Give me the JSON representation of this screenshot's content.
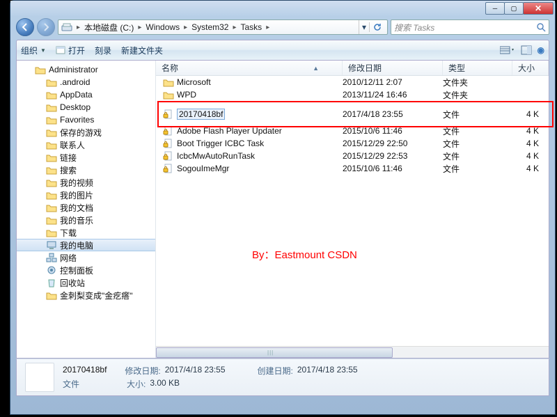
{
  "breadcrumb": {
    "items": [
      "本地磁盘 (C:)",
      "Windows",
      "System32",
      "Tasks"
    ]
  },
  "search": {
    "placeholder": "搜索 Tasks"
  },
  "toolbar": {
    "organize": "组织",
    "open": "打开",
    "burn": "刻录",
    "newfolder": "新建文件夹"
  },
  "tree": {
    "root": "Administrator",
    "items": [
      ".android",
      "AppData",
      "Desktop",
      "Favorites",
      "保存的游戏",
      "联系人",
      "链接",
      "搜索",
      "我的视频",
      "我的图片",
      "我的文档",
      "我的音乐",
      "下载",
      "我的电脑",
      "网络",
      "控制面板",
      "回收站",
      "金刺梨变成\"金疙瘩\""
    ],
    "selected_index": 13
  },
  "columns": {
    "name": "名称",
    "date": "修改日期",
    "type": "类型",
    "size": "大小"
  },
  "files": [
    {
      "name": "Microsoft",
      "date": "2010/12/11 2:07",
      "type": "文件夹",
      "size": "",
      "icon": "folder"
    },
    {
      "name": "WPD",
      "date": "2013/11/24 16:46",
      "type": "文件夹",
      "size": "",
      "icon": "folder"
    },
    {
      "name": "20170418bf",
      "date": "2017/4/18 23:55",
      "type": "文件",
      "size": "4 K",
      "icon": "lockfile",
      "selected": true
    },
    {
      "name": "Adobe Flash Player Updater",
      "date": "2015/10/6 11:46",
      "type": "文件",
      "size": "4 K",
      "icon": "lockfile"
    },
    {
      "name": "Boot Trigger ICBC Task",
      "date": "2015/12/29 22:50",
      "type": "文件",
      "size": "4 K",
      "icon": "lockfile"
    },
    {
      "name": "IcbcMwAutoRunTask",
      "date": "2015/12/29 22:53",
      "type": "文件",
      "size": "4 K",
      "icon": "lockfile"
    },
    {
      "name": "SogouImeMgr",
      "date": "2015/10/6 11:46",
      "type": "文件",
      "size": "4 K",
      "icon": "lockfile"
    }
  ],
  "watermark": "By：Eastmount CSDN",
  "details": {
    "name": "20170418bf",
    "type": "文件",
    "mod_label": "修改日期:",
    "mod_value": "2017/4/18 23:55",
    "create_label": "创建日期:",
    "create_value": "2017/4/18 23:55",
    "size_label": "大小:",
    "size_value": "3.00 KB"
  }
}
